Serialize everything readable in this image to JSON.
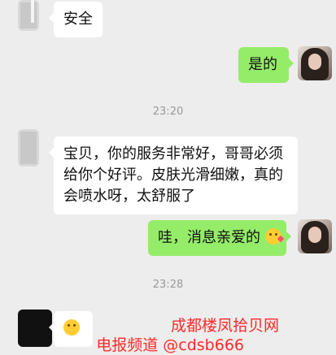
{
  "messages": [
    {
      "side": "in",
      "text": "安全"
    },
    {
      "side": "out",
      "text": "是的"
    },
    {
      "side": "time",
      "text": "23:20"
    },
    {
      "side": "in",
      "lines": [
        "宝贝，你的服务非常好，哥哥必须",
        "给你个好评。皮肤光滑细嫩，真的",
        "会喷水呀，太舒服了"
      ]
    },
    {
      "side": "out",
      "text": "哇，消息亲爱的",
      "emoji": "kiss-heart-emoji"
    },
    {
      "side": "time",
      "text": "23:28"
    },
    {
      "side": "in",
      "emoji": "cheeky-face-emoji"
    }
  ],
  "watermark": {
    "line1": "成都楼凤拾贝网",
    "line2": "电报频道 @cdsb666"
  },
  "colors": {
    "background": "#ededed",
    "bubble_in": "#ffffff",
    "bubble_out": "#95ec69",
    "time": "#999999",
    "watermark": "#ff2a2a"
  }
}
